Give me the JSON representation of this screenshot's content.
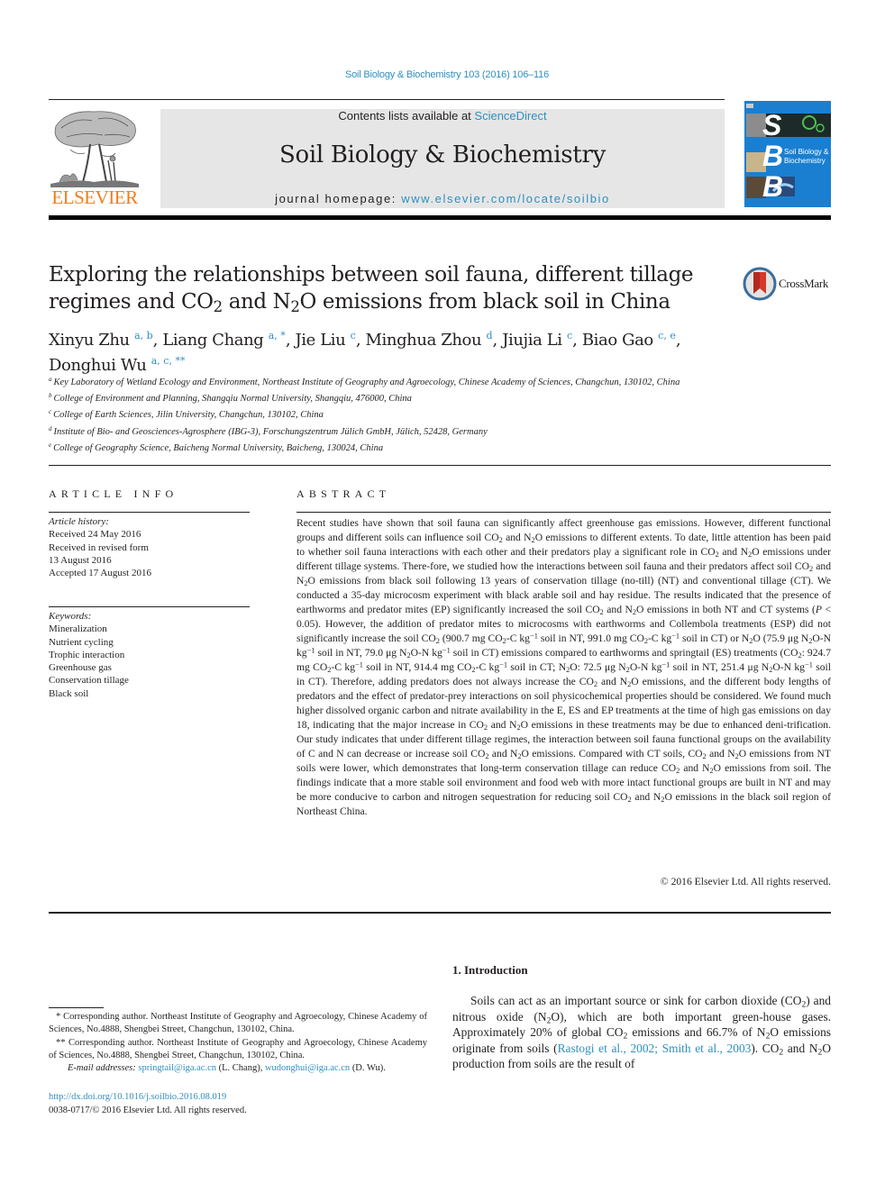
{
  "header": {
    "citation": "Soil Biology & Biochemistry 103 (2016) 106–116",
    "contents_prefix": "Contents lists available at ",
    "contents_link": "ScienceDirect",
    "journal_title": "Soil Biology & Biochemistry",
    "homepage_prefix": "journal homepage: ",
    "homepage_link": "www.elsevier.com/locate/soilbio",
    "publisher_logo_text": "ELSEVIER",
    "cover": {
      "letters": [
        "S",
        "B",
        "B"
      ],
      "title_line1": "Soil Biology &",
      "title_line2": "Biochemistry"
    },
    "colors": {
      "link": "#2f8fbf",
      "elsevier_orange": "#f07d1a",
      "cover_blue": "#1a7fd0",
      "band_gray": "#e6e6e6"
    }
  },
  "article": {
    "title_line1": "Exploring the relationships between soil fauna, different tillage",
    "title_line2_a": "regimes and CO",
    "title_line2_b": " and N",
    "title_line2_c": "O emissions from black soil in China",
    "crossmark_label": "CrossMark",
    "authors": [
      {
        "name": "Xinyu Zhu",
        "affil": "a, b"
      },
      {
        "name": "Liang Chang",
        "affil": "a, *"
      },
      {
        "name": "Jie Liu",
        "affil": "c"
      },
      {
        "name": "Minghua Zhou",
        "affil": "d"
      },
      {
        "name": "Jiujia Li",
        "affil": "c"
      },
      {
        "name": "Biao Gao",
        "affil": "c, e"
      },
      {
        "name": "Donghui Wu",
        "affil": "a, c, **"
      }
    ],
    "affiliations": [
      {
        "key": "a",
        "text": "Key Laboratory of Wetland Ecology and Environment, Northeast Institute of Geography and Agroecology, Chinese Academy of Sciences, Changchun, 130102, China"
      },
      {
        "key": "b",
        "text": "College of Environment and Planning, Shangqiu Normal University, Shangqiu, 476000, China"
      },
      {
        "key": "c",
        "text": "College of Earth Sciences, Jilin University, Changchun, 130102, China"
      },
      {
        "key": "d",
        "text": "Institute of Bio- and Geosciences-Agrosphere (IBG-3), Forschungszentrum Jülich GmbH, Jülich, 52428, Germany"
      },
      {
        "key": "e",
        "text": "College of Geography Science, Baicheng Normal University, Baicheng, 130024, China"
      }
    ]
  },
  "article_info": {
    "heading": "ARTICLE INFO",
    "history_label": "Article history:",
    "history": [
      "Received 24 May 2016",
      "Received in revised form",
      "13 August 2016",
      "Accepted 17 August 2016"
    ],
    "keywords_label": "Keywords:",
    "keywords": [
      "Mineralization",
      "Nutrient cycling",
      "Trophic interaction",
      "Greenhouse gas",
      "Conservation tillage",
      "Black soil"
    ]
  },
  "abstract": {
    "heading": "ABSTRACT",
    "html": "Recent studies have shown that soil fauna can significantly affect greenhouse gas emissions. However, different functional groups and different soils can influence soil CO<sub>2</sub> and N<sub>2</sub>O emissions to different extents. To date, little attention has been paid to whether soil fauna interactions with each other and their predators play a significant role in CO<sub>2</sub> and N<sub>2</sub>O emissions under different tillage systems. There-fore, we studied how the interactions between soil fauna and their predators affect soil CO<sub>2</sub> and N<sub>2</sub>O emissions from black soil following 13 years of conservation tillage (no-till) (NT) and conventional tillage (CT). We conducted a 35-day microcosm experiment with black arable soil and hay residue. The results indicated that the presence of earthworms and predator mites (EP) significantly increased the soil CO<sub>2</sub> and N<sub>2</sub>O emissions in both NT and CT systems (<i>P</i> &lt; 0.05). However, the addition of predator mites to microcosms with earthworms and Collembola treatments (ESP) did not significantly increase the soil CO<sub>2</sub> (900.7 mg CO<sub>2</sub>-C kg<sup class=\"m\">−1</sup> soil in NT, 991.0 mg CO<sub>2</sub>-C kg<sup class=\"m\">−1</sup> soil in CT) or N<sub>2</sub>O (75.9 μg N<sub>2</sub>O-N kg<sup class=\"m\">−1</sup> soil in NT, 79.0 μg N<sub>2</sub>O-N kg<sup class=\"m\">−1</sup> soil in CT) emissions compared to earthworms and springtail (ES) treatments (CO<sub>2</sub>: 924.7 mg CO<sub>2</sub>-C kg<sup class=\"m\">−1</sup> soil in NT, 914.4 mg CO<sub>2</sub>-C kg<sup class=\"m\">−1</sup> soil in CT; N<sub>2</sub>O: 72.5 μg N<sub>2</sub>O-N kg<sup class=\"m\">−1</sup> soil in NT, 251.4 μg N<sub>2</sub>O-N kg<sup class=\"m\">−1</sup> soil in CT). Therefore, adding predators does not always increase the CO<sub>2</sub> and N<sub>2</sub>O emissions, and the different body lengths of predators and the effect of predator-prey interactions on soil physicochemical properties should be considered. We found much higher dissolved organic carbon and nitrate availability in the E, ES and EP treatments at the time of high gas emissions on day 18, indicating that the major increase in CO<sub>2</sub> and N<sub>2</sub>O emissions in these treatments may be due to enhanced deni-trification. Our study indicates that under different tillage regimes, the interaction between soil fauna functional groups on the availability of C and N can decrease or increase soil CO<sub>2</sub> and N<sub>2</sub>O emissions. Compared with CT soils, CO<sub>2</sub> and N<sub>2</sub>O emissions from NT soils were lower, which demonstrates that long-term conservation tillage can reduce CO<sub>2</sub> and N<sub>2</sub>O emissions from soil. The findings indicate that a more stable soil environment and food web with more intact functional groups are built in NT and may be more conducive to carbon and nitrogen sequestration for reducing soil CO<sub>2</sub> and N<sub>2</sub>O emissions in the black soil region of Northeast China.",
    "copyright": "© 2016 Elsevier Ltd. All rights reserved."
  },
  "footnotes": {
    "corr1": "* Corresponding author. Northeast Institute of Geography and Agroecology, Chinese Academy of Sciences, No.4888, Shengbei Street, Changchun, 130102, China.",
    "corr2": "** Corresponding author. Northeast Institute of Geography and Agroecology, Chinese Academy of Sciences, No.4888, Shengbei Street, Changchun, 130102, China.",
    "email_label": "E-mail addresses: ",
    "email1": "springtail@iga.ac.cn",
    "email1_who": " (L. Chang), ",
    "email2": "wudonghui@iga.ac.cn",
    "email2_who": " (D. Wu).",
    "doi": "http://dx.doi.org/10.1016/j.soilbio.2016.08.019",
    "issn": "0038-0717/© 2016 Elsevier Ltd. All rights reserved."
  },
  "introduction": {
    "heading": "1.  Introduction",
    "html": "Soils can act as an important source or sink for carbon dioxide (CO<sub>2</sub>) and nitrous oxide (N<sub>2</sub>O), which are both important green-house gases. Approximately 20% of global CO<sub>2</sub> emissions and 66.7% of N<sub>2</sub>O emissions originate from soils (<a class=\"link\" data-name=\"citation-link\" data-interactable=\"true\">Rastogi et al., 2002; Smith et al., 2003</a>). CO<sub>2</sub> and N<sub>2</sub>O production from soils are the result of"
  }
}
